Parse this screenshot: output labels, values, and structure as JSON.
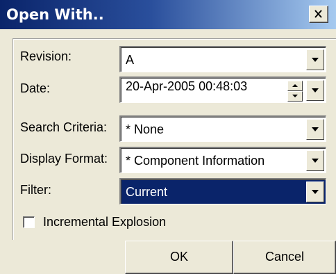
{
  "window": {
    "title": "Open With..",
    "close_symbol": "✕"
  },
  "form": {
    "revision": {
      "label": "Revision:",
      "value": "A"
    },
    "date": {
      "label": "Date:",
      "value": "20-Apr-2005 00:48:03"
    },
    "search_criteria": {
      "label": "Search Criteria:",
      "value": "* None"
    },
    "display_format": {
      "label": "Display Format:",
      "value": "* Component Information"
    },
    "filter": {
      "label": "Filter:",
      "value": "Current"
    },
    "incremental_explosion": {
      "label": "Incremental Explosion",
      "checked": false
    }
  },
  "buttons": {
    "ok": "OK",
    "cancel": "Cancel"
  },
  "colors": {
    "titlebar": "#0a246a",
    "selection": "#0a246a",
    "face": "#ece9d8"
  },
  "icons": [
    "close-icon",
    "chevron-down-icon",
    "spin-up-icon",
    "spin-down-icon"
  ]
}
